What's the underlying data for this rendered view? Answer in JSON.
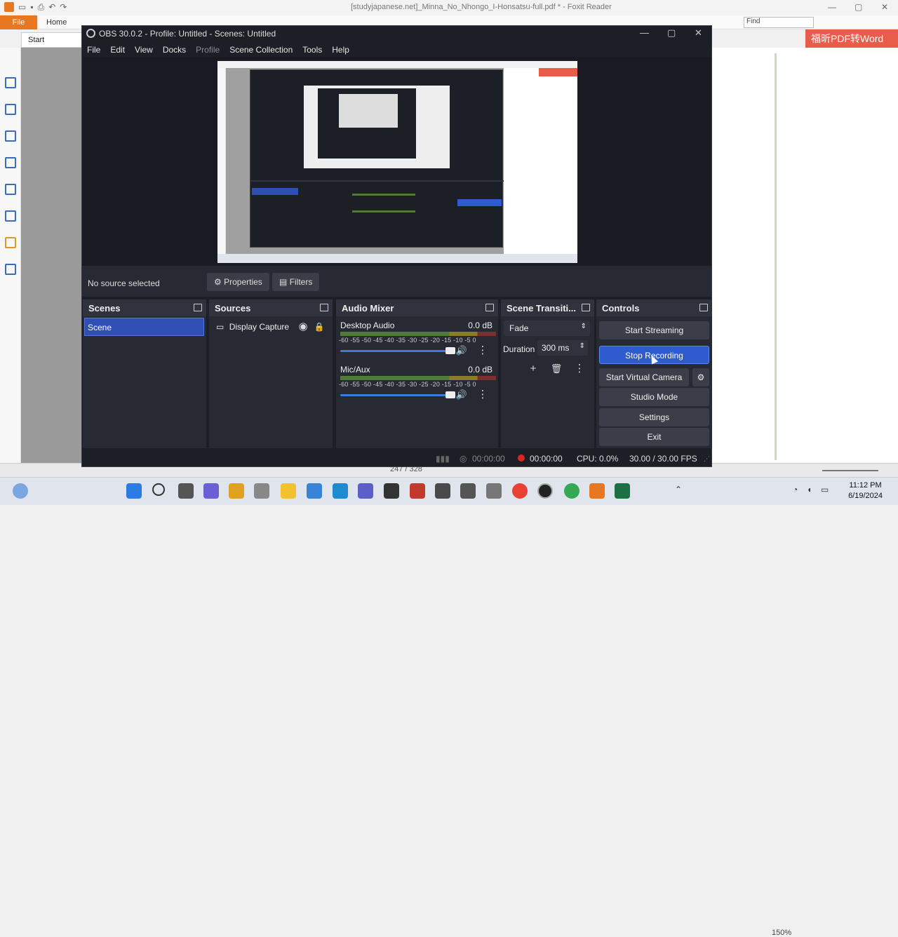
{
  "foxit": {
    "title": "[studyjapanese.net]_Minna_No_Nhongo_I-Honsatsu-full.pdf * - Foxit Reader",
    "file_tab": "File",
    "home_tab": "Home",
    "find_placeholder": "Find",
    "promo": "福昕PDF转Word",
    "doc_tab": "Start",
    "zoom": "150%",
    "page_indicator": "247 / 328"
  },
  "taskbar": {
    "time": "11:12 PM",
    "date": "6/19/2024"
  },
  "obs": {
    "title": "OBS 30.0.2 - Profile: Untitled - Scenes: Untitled",
    "menu": [
      "File",
      "Edit",
      "View",
      "Docks",
      "Profile",
      "Scene Collection",
      "Tools",
      "Help"
    ],
    "no_source": "No source selected",
    "properties_label": "Properties",
    "filters_label": "Filters",
    "scenes": {
      "title": "Scenes",
      "items": [
        "Scene"
      ]
    },
    "sources": {
      "title": "Sources",
      "items": [
        "Display Capture"
      ]
    },
    "audio_mixer": {
      "title": "Audio Mixer",
      "scale": "-60 -55 -50 -45 -40 -35 -30 -25 -20 -15 -10 -5 0",
      "channels": [
        {
          "name": "Desktop Audio",
          "db": "0.0 dB",
          "volume": 0.9
        },
        {
          "name": "Mic/Aux",
          "db": "0.0 dB",
          "volume": 0.9
        }
      ]
    },
    "transitions": {
      "title": "Scene Transiti...",
      "type": "Fade",
      "duration_label": "Duration",
      "duration_value": "300 ms"
    },
    "controls": {
      "title": "Controls",
      "start_streaming": "Start Streaming",
      "stop_recording": "Stop Recording",
      "start_virtual_camera": "Start Virtual Camera",
      "studio_mode": "Studio Mode",
      "settings": "Settings",
      "exit": "Exit"
    },
    "status": {
      "stream_time": "00:00:00",
      "rec_time": "00:00:00",
      "cpu": "CPU: 0.0%",
      "fps": "30.00 / 30.00 FPS"
    },
    "colors": {
      "accent": "#2f5bd0",
      "record_dot": "#e02424"
    }
  }
}
